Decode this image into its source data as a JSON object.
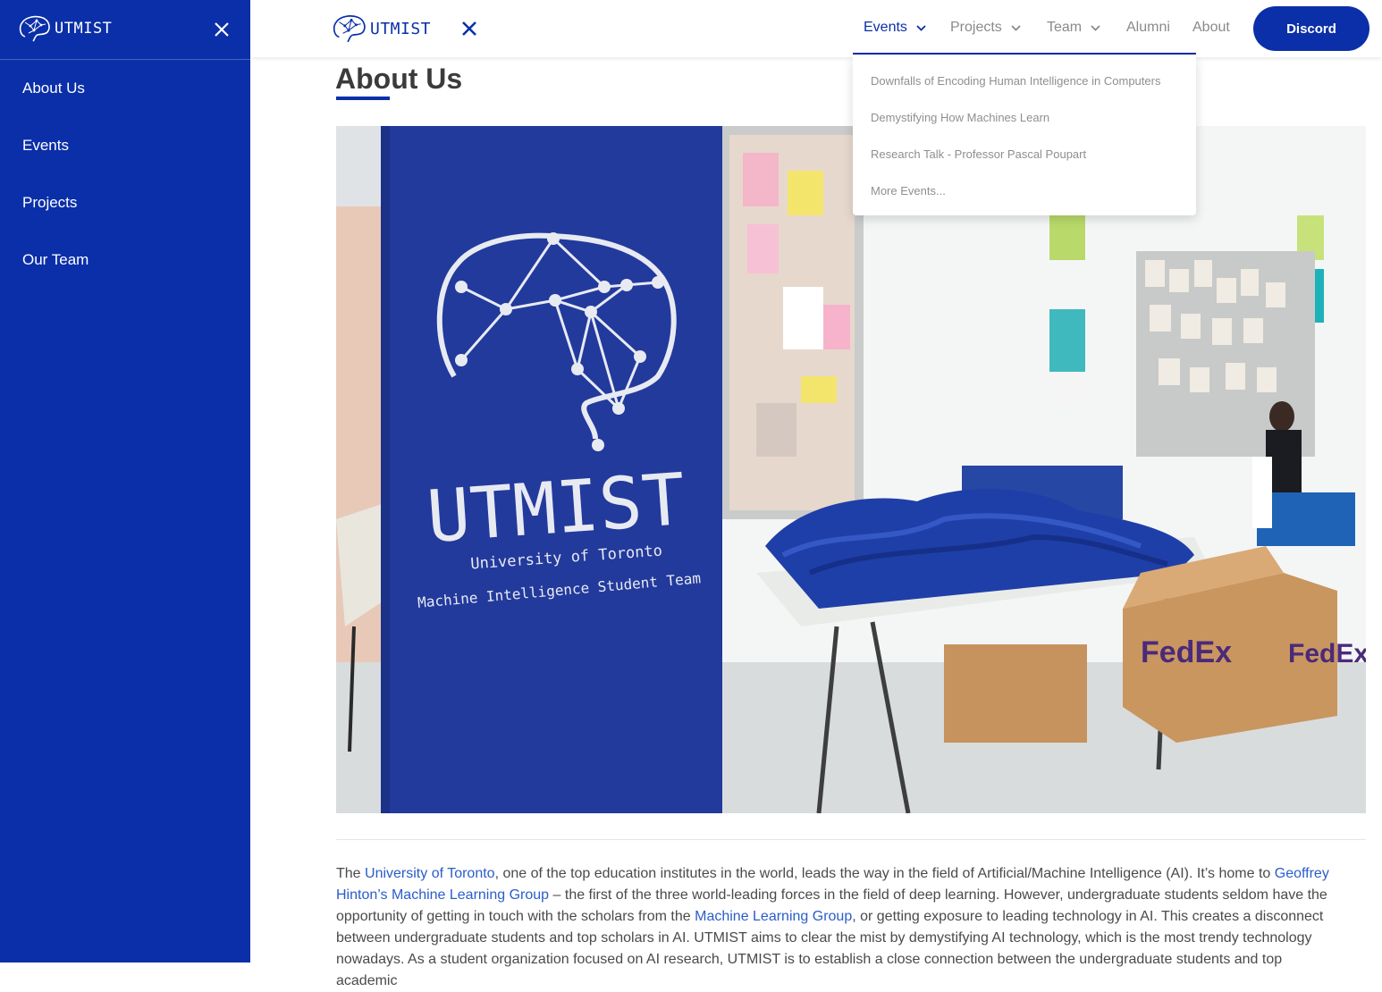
{
  "drawer": {
    "brand": "UTMIST",
    "items": [
      {
        "label": "About Us"
      },
      {
        "label": "Events"
      },
      {
        "label": "Projects"
      },
      {
        "label": "Our Team"
      }
    ]
  },
  "header": {
    "brand": "UTMIST",
    "nav": [
      {
        "label": "Events",
        "has_dropdown": true,
        "active": true
      },
      {
        "label": "Projects",
        "has_dropdown": true
      },
      {
        "label": "Team",
        "has_dropdown": true
      },
      {
        "label": "Alumni"
      },
      {
        "label": "About"
      }
    ],
    "discord_label": "Discord"
  },
  "events_dropdown": {
    "items": [
      {
        "label": "Downfalls of Encoding Human Intelligence in Computers"
      },
      {
        "label": "Demystifying How Machines Learn"
      },
      {
        "label": "Research Talk - Professor Pascal Poupart"
      },
      {
        "label": "More Events..."
      }
    ]
  },
  "main": {
    "title": "About Us",
    "banner": {
      "name": "UTMIST",
      "line1": "University of Toronto",
      "line2": "Machine Intelligence Student Team"
    },
    "box_text": "FedEx",
    "body": {
      "t1": "The ",
      "l1": "University of Toronto",
      "t2": ", one of the top education institutes in the world, leads the way in the field of Artificial/Machine Intelligence (AI). It’s home to ",
      "l2": "Geoffrey Hinton’s Machine Learning Group",
      "t3": " – the first of the three world-leading forces in the field of deep learning. However, undergraduate students seldom have the opportunity of getting in touch with the scholars from the ",
      "l3": "Machine Learning Group",
      "t4": ", or getting exposure to leading technology in AI. This creates a disconnect between undergraduate students and top scholars in AI. UTMIST aims to clear the mist by demystifying AI technology, which is the most trendy technology nowadays. As a student organization focused on AI research, UTMIST is to establish a close connection between the undergraduate students and top academic"
    }
  },
  "colors": {
    "brand_blue": "#0b2fa8",
    "link_blue": "#2a5dc9",
    "muted_text": "#8a8a8a"
  }
}
